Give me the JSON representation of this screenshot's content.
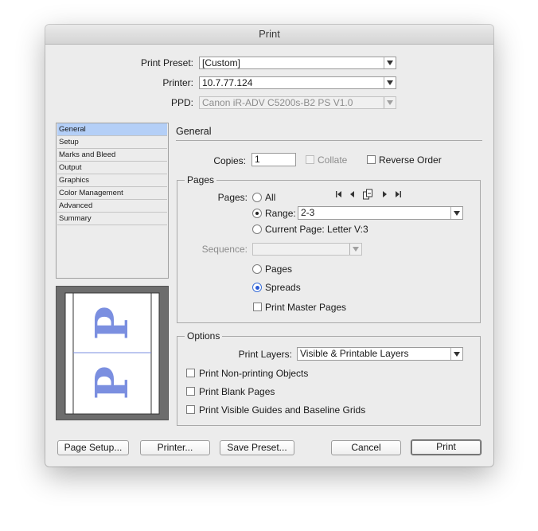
{
  "window": {
    "title": "Print"
  },
  "header": {
    "print_preset_label": "Print Preset:",
    "print_preset_value": "[Custom]",
    "printer_label": "Printer:",
    "printer_value": "10.7.77.124",
    "ppd_label": "PPD:",
    "ppd_value": "Canon iR-ADV C5200s-B2 PS V1.0"
  },
  "sidebar": {
    "items": [
      {
        "label": "General",
        "selected": true
      },
      {
        "label": "Setup"
      },
      {
        "label": "Marks and Bleed"
      },
      {
        "label": "Output"
      },
      {
        "label": "Graphics"
      },
      {
        "label": "Color Management"
      },
      {
        "label": "Advanced"
      },
      {
        "label": "Summary"
      }
    ]
  },
  "preview": {
    "glyph": "P"
  },
  "general": {
    "section_title": "General",
    "copies_label": "Copies:",
    "copies_value": "1",
    "collate_label": "Collate",
    "reverse_order_label": "Reverse Order"
  },
  "pages": {
    "group_title": "Pages",
    "pages_label": "Pages:",
    "all_label": "All",
    "range_label": "Range:",
    "range_value": "2-3",
    "current_page_label": "Current Page: Letter V:3",
    "sequence_label": "Sequence:",
    "sequence_value": "",
    "pages_option_label": "Pages",
    "spreads_option_label": "Spreads",
    "print_master_pages_label": "Print Master Pages",
    "selected_page_mode": "Range",
    "selected_layout": "Spreads"
  },
  "options": {
    "group_title": "Options",
    "print_layers_label": "Print Layers:",
    "print_layers_value": "Visible & Printable Layers",
    "non_printing_label": "Print Non-printing Objects",
    "blank_pages_label": "Print Blank Pages",
    "guides_label": "Print Visible Guides and Baseline Grids"
  },
  "buttons": {
    "page_setup": "Page Setup...",
    "printer": "Printer...",
    "save_preset": "Save Preset...",
    "cancel": "Cancel",
    "print": "Print"
  },
  "icons": {
    "first": "first-page-icon",
    "prev": "previous-page-icon",
    "spread": "page-spread-icon",
    "next": "next-page-icon",
    "last": "last-page-icon"
  },
  "colors": {
    "selection": "#b4cff7",
    "preview_glyph": "#7b8fe0",
    "radio_accent": "#2b5bd6"
  }
}
